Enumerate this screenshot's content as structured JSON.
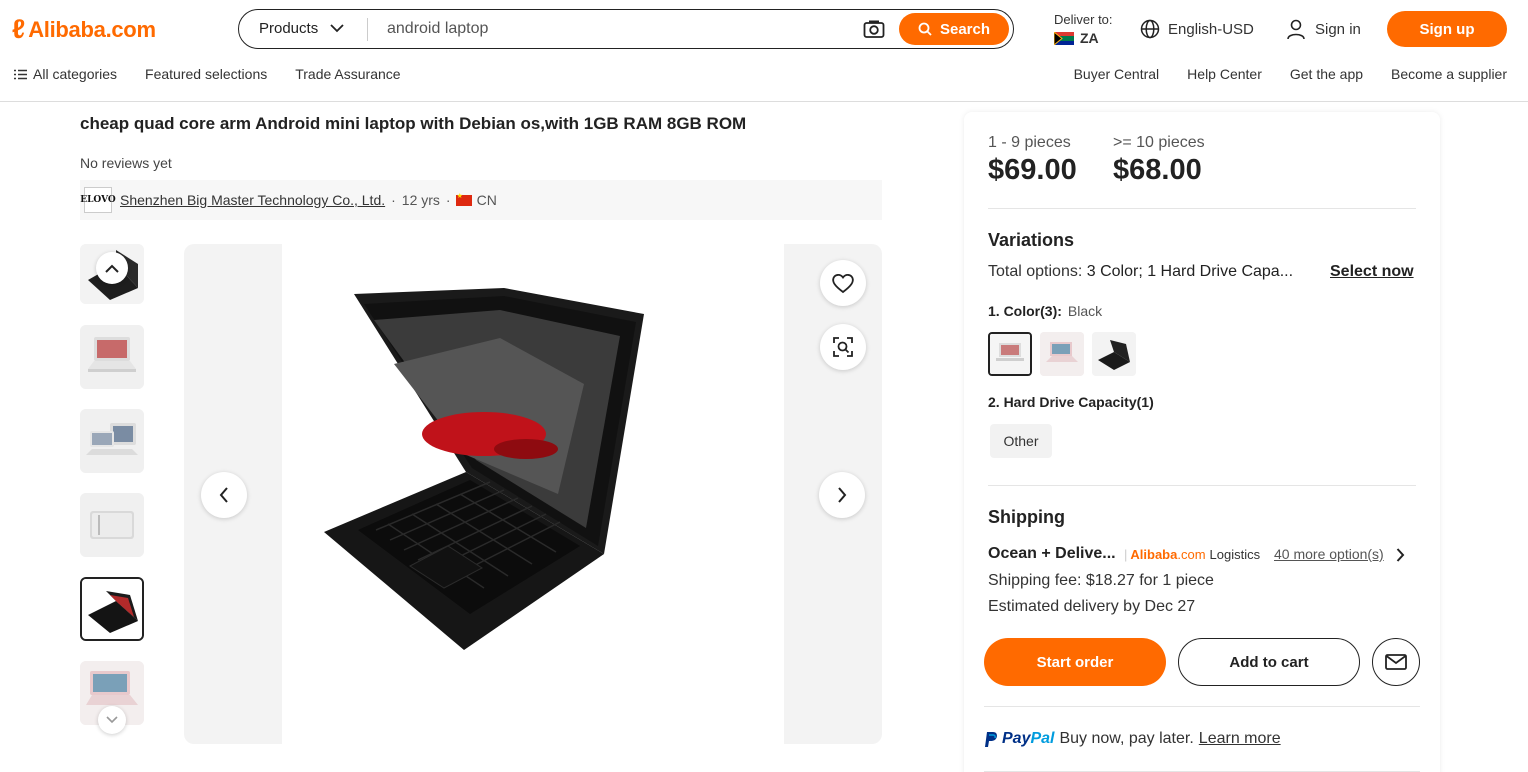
{
  "header": {
    "logo_text": "Alibaba.com",
    "search_category": "Products",
    "search_value": "android laptop",
    "search_button": "Search",
    "deliver_label": "Deliver to:",
    "deliver_country": "ZA",
    "language": "English-USD",
    "sign_in": "Sign in",
    "sign_up": "Sign up"
  },
  "nav": {
    "left": [
      "All categories",
      "Featured selections",
      "Trade Assurance"
    ],
    "right": [
      "Buyer Central",
      "Help Center",
      "Get the app",
      "Become a supplier"
    ]
  },
  "product": {
    "title": "cheap quad core arm Android mini laptop with Debian os,with 1GB RAM 8GB ROM",
    "reviews": "No reviews yet",
    "supplier_logo": "ELOVO",
    "supplier_name": "Shenzhen Big Master Technology Co., Ltd.",
    "supplier_years": "12 yrs",
    "supplier_country": "CN"
  },
  "pricing": {
    "tiers": [
      {
        "qty": "1 - 9 pieces",
        "price": "$69.00"
      },
      {
        "qty": ">= 10 pieces",
        "price": "$68.00"
      }
    ]
  },
  "variations": {
    "title": "Variations",
    "total_prefix": "Total options:",
    "total_value": "3 Color; 1 Hard Drive Capa...",
    "select_now": "Select now",
    "color_label": "1. Color(3):",
    "color_selected": "Black",
    "hdd_label": "2. Hard Drive Capacity(1)",
    "hdd_option": "Other"
  },
  "shipping": {
    "title": "Shipping",
    "method": "Ocean + Delive...",
    "logistics_brand": "Alibaba",
    "logistics_com": ".com",
    "logistics_word": "Logistics",
    "more_options": "40 more option(s)",
    "fee": "Shipping fee: $18.27 for 1 piece",
    "estimate": "Estimated delivery by Dec 27"
  },
  "actions": {
    "start_order": "Start order",
    "add_to_cart": "Add to cart"
  },
  "paypal": {
    "brand_pay": "Pay",
    "brand_pal": "Pal",
    "text": "Buy now, pay later.",
    "learn_more": "Learn more"
  },
  "colors": {
    "accent": "#ff6a00",
    "text": "#222222"
  }
}
